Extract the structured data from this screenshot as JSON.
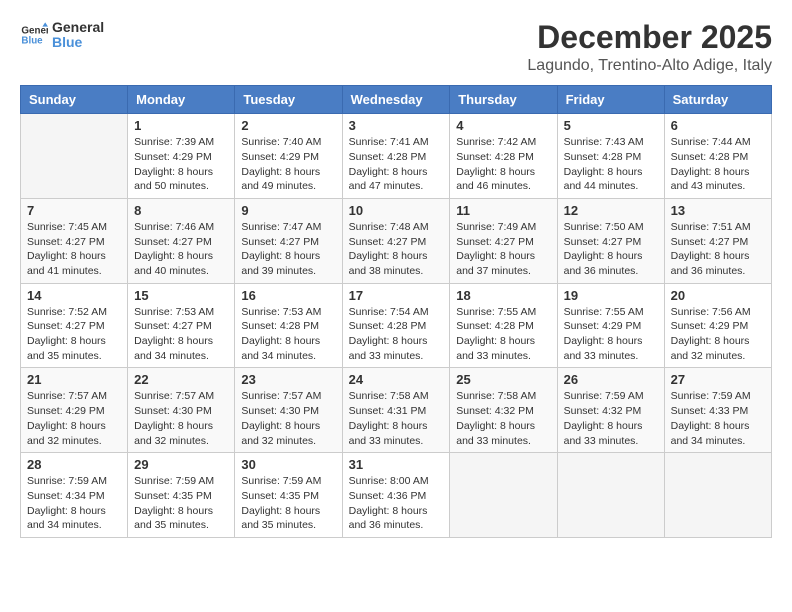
{
  "logo": {
    "line1": "General",
    "line2": "Blue"
  },
  "title": "December 2025",
  "location": "Lagundo, Trentino-Alto Adige, Italy",
  "weekdays": [
    "Sunday",
    "Monday",
    "Tuesday",
    "Wednesday",
    "Thursday",
    "Friday",
    "Saturday"
  ],
  "weeks": [
    [
      {
        "day": "",
        "info": ""
      },
      {
        "day": "1",
        "info": "Sunrise: 7:39 AM\nSunset: 4:29 PM\nDaylight: 8 hours\nand 50 minutes."
      },
      {
        "day": "2",
        "info": "Sunrise: 7:40 AM\nSunset: 4:29 PM\nDaylight: 8 hours\nand 49 minutes."
      },
      {
        "day": "3",
        "info": "Sunrise: 7:41 AM\nSunset: 4:28 PM\nDaylight: 8 hours\nand 47 minutes."
      },
      {
        "day": "4",
        "info": "Sunrise: 7:42 AM\nSunset: 4:28 PM\nDaylight: 8 hours\nand 46 minutes."
      },
      {
        "day": "5",
        "info": "Sunrise: 7:43 AM\nSunset: 4:28 PM\nDaylight: 8 hours\nand 44 minutes."
      },
      {
        "day": "6",
        "info": "Sunrise: 7:44 AM\nSunset: 4:28 PM\nDaylight: 8 hours\nand 43 minutes."
      }
    ],
    [
      {
        "day": "7",
        "info": "Sunrise: 7:45 AM\nSunset: 4:27 PM\nDaylight: 8 hours\nand 41 minutes."
      },
      {
        "day": "8",
        "info": "Sunrise: 7:46 AM\nSunset: 4:27 PM\nDaylight: 8 hours\nand 40 minutes."
      },
      {
        "day": "9",
        "info": "Sunrise: 7:47 AM\nSunset: 4:27 PM\nDaylight: 8 hours\nand 39 minutes."
      },
      {
        "day": "10",
        "info": "Sunrise: 7:48 AM\nSunset: 4:27 PM\nDaylight: 8 hours\nand 38 minutes."
      },
      {
        "day": "11",
        "info": "Sunrise: 7:49 AM\nSunset: 4:27 PM\nDaylight: 8 hours\nand 37 minutes."
      },
      {
        "day": "12",
        "info": "Sunrise: 7:50 AM\nSunset: 4:27 PM\nDaylight: 8 hours\nand 36 minutes."
      },
      {
        "day": "13",
        "info": "Sunrise: 7:51 AM\nSunset: 4:27 PM\nDaylight: 8 hours\nand 36 minutes."
      }
    ],
    [
      {
        "day": "14",
        "info": "Sunrise: 7:52 AM\nSunset: 4:27 PM\nDaylight: 8 hours\nand 35 minutes."
      },
      {
        "day": "15",
        "info": "Sunrise: 7:53 AM\nSunset: 4:27 PM\nDaylight: 8 hours\nand 34 minutes."
      },
      {
        "day": "16",
        "info": "Sunrise: 7:53 AM\nSunset: 4:28 PM\nDaylight: 8 hours\nand 34 minutes."
      },
      {
        "day": "17",
        "info": "Sunrise: 7:54 AM\nSunset: 4:28 PM\nDaylight: 8 hours\nand 33 minutes."
      },
      {
        "day": "18",
        "info": "Sunrise: 7:55 AM\nSunset: 4:28 PM\nDaylight: 8 hours\nand 33 minutes."
      },
      {
        "day": "19",
        "info": "Sunrise: 7:55 AM\nSunset: 4:29 PM\nDaylight: 8 hours\nand 33 minutes."
      },
      {
        "day": "20",
        "info": "Sunrise: 7:56 AM\nSunset: 4:29 PM\nDaylight: 8 hours\nand 32 minutes."
      }
    ],
    [
      {
        "day": "21",
        "info": "Sunrise: 7:57 AM\nSunset: 4:29 PM\nDaylight: 8 hours\nand 32 minutes."
      },
      {
        "day": "22",
        "info": "Sunrise: 7:57 AM\nSunset: 4:30 PM\nDaylight: 8 hours\nand 32 minutes."
      },
      {
        "day": "23",
        "info": "Sunrise: 7:57 AM\nSunset: 4:30 PM\nDaylight: 8 hours\nand 32 minutes."
      },
      {
        "day": "24",
        "info": "Sunrise: 7:58 AM\nSunset: 4:31 PM\nDaylight: 8 hours\nand 33 minutes."
      },
      {
        "day": "25",
        "info": "Sunrise: 7:58 AM\nSunset: 4:32 PM\nDaylight: 8 hours\nand 33 minutes."
      },
      {
        "day": "26",
        "info": "Sunrise: 7:59 AM\nSunset: 4:32 PM\nDaylight: 8 hours\nand 33 minutes."
      },
      {
        "day": "27",
        "info": "Sunrise: 7:59 AM\nSunset: 4:33 PM\nDaylight: 8 hours\nand 34 minutes."
      }
    ],
    [
      {
        "day": "28",
        "info": "Sunrise: 7:59 AM\nSunset: 4:34 PM\nDaylight: 8 hours\nand 34 minutes."
      },
      {
        "day": "29",
        "info": "Sunrise: 7:59 AM\nSunset: 4:35 PM\nDaylight: 8 hours\nand 35 minutes."
      },
      {
        "day": "30",
        "info": "Sunrise: 7:59 AM\nSunset: 4:35 PM\nDaylight: 8 hours\nand 35 minutes."
      },
      {
        "day": "31",
        "info": "Sunrise: 8:00 AM\nSunset: 4:36 PM\nDaylight: 8 hours\nand 36 minutes."
      },
      {
        "day": "",
        "info": ""
      },
      {
        "day": "",
        "info": ""
      },
      {
        "day": "",
        "info": ""
      }
    ]
  ]
}
